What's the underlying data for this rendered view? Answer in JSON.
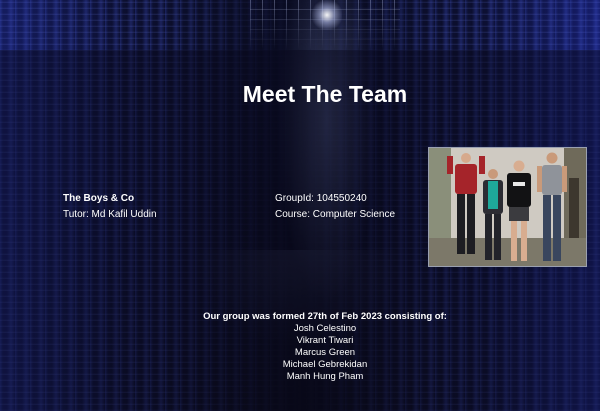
{
  "page": {
    "title": "Meet The Team"
  },
  "team": {
    "name": "The Boys & Co",
    "tutor": "Tutor: Md Kafil Uddin",
    "group_id": "GroupId: 104550240",
    "course": "Course: Computer Science"
  },
  "members": {
    "heading": "Our group was formed 27th of Feb 2023 consisting of:",
    "list": [
      "Josh Celestino",
      "Vikrant Tiwari",
      "Marcus Green",
      "Michael Gebrekidan",
      "Manh Hung Pham"
    ]
  },
  "colors": {
    "text": "#ffffff",
    "background": "#090a1c",
    "rack_glow": "#3c50c8"
  }
}
